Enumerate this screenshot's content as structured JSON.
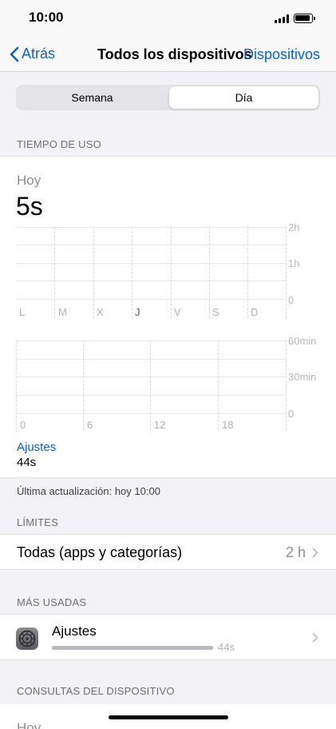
{
  "status_bar": {
    "time": "10:00"
  },
  "nav": {
    "back_label": "Atrás",
    "title": "Todos los dispositivos",
    "right_link": "Dispositivos"
  },
  "segmented": {
    "options": [
      "Semana",
      "Día"
    ],
    "selected": "Día"
  },
  "usage": {
    "section_title": "TIEMPO DE USO",
    "period_label": "Hoy",
    "total": "5s",
    "weekly_chart": {
      "y_ticks": [
        "2h",
        "1h",
        "0"
      ],
      "days": [
        "L",
        "M",
        "X",
        "J",
        "V",
        "S",
        "D"
      ],
      "highlighted_day": "J"
    },
    "hourly_chart": {
      "y_ticks": [
        "60min",
        "30min",
        "0"
      ],
      "hours": [
        "0",
        "6",
        "12",
        "18"
      ]
    },
    "top_app": {
      "name": "Ajustes",
      "time": "44s"
    }
  },
  "last_update": "Última actualización: hoy 10:00",
  "limits": {
    "section_title": "LÍMITES",
    "row_label": "Todas (apps y categorías)",
    "row_value": "2 h"
  },
  "most_used": {
    "section_title": "MÁS USADAS",
    "items": [
      {
        "name": "Ajustes",
        "time": "44s",
        "share": 1.0,
        "icon": "settings-gear-icon"
      }
    ]
  },
  "device_pickups": {
    "section_title": "CONSULTAS DEL DISPOSITIVO",
    "partial_label": "Hoy"
  },
  "colors": {
    "accent": "#0a60d6",
    "background": "#f2f2f7",
    "secondary_text": "#8e8e93"
  }
}
